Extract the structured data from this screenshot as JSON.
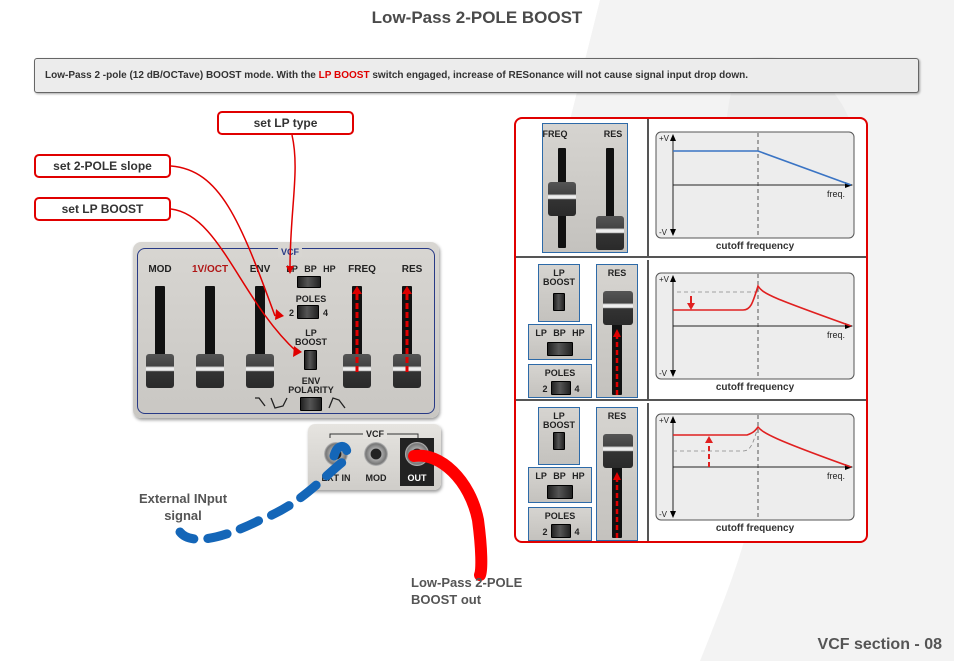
{
  "title": "Low-Pass 2-POLE BOOST",
  "description": {
    "before": "Low-Pass 2 -pole (12 dB/OCTave) BOOST mode. With the ",
    "highlight": "LP BOOST",
    "after": " switch engaged, increase of RESonance will not cause signal input drop down."
  },
  "callouts": {
    "lp_type": "set LP type",
    "pole_slope": "set 2-POLE slope",
    "lp_boost": "set LP BOOST"
  },
  "vcf_panel": {
    "section_tag": "VCF",
    "channels": [
      "MOD",
      "1V/OCT",
      "ENV",
      "FREQ",
      "RES"
    ],
    "filter_type": {
      "options": [
        "LP",
        "BP",
        "HP"
      ],
      "selected": "LP"
    },
    "poles": {
      "label": "POLES",
      "options": [
        "2",
        "4"
      ],
      "selected": "2"
    },
    "lp_boost": {
      "label_line1": "LP",
      "label_line2": "BOOST",
      "state": "on"
    },
    "env_polarity": {
      "label_line1": "ENV",
      "label_line2": "POLARITY"
    }
  },
  "jacks": {
    "section_tag": "VCF",
    "items": [
      "EXT IN",
      "MOD",
      "OUT"
    ]
  },
  "annotations": {
    "external_input_line1": "External INput",
    "external_input_line2": "signal",
    "output_line1": "Low-Pass 2-POLE",
    "output_line2": "BOOST out"
  },
  "diagram": {
    "rows": [
      {
        "controls": {
          "sliders": [
            "FREQ",
            "RES"
          ]
        },
        "graph": {
          "y_top": "+V",
          "y_bottom": "-V",
          "x_label": "freq.",
          "caption": "cutoff frequency",
          "curve": "flat-then-rolloff",
          "color": "#3a74c4"
        }
      },
      {
        "controls": {
          "lp_boost": "LP BOOST",
          "type_options": [
            "LP",
            "BP",
            "HP"
          ],
          "poles_label": "POLES",
          "poles_options": [
            "2",
            "4"
          ],
          "slider": "RES"
        },
        "graph": {
          "y_top": "+V",
          "y_bottom": "-V",
          "x_label": "freq.",
          "caption": "cutoff frequency",
          "curve": "resonance-drop",
          "color": "#e02020"
        }
      },
      {
        "controls": {
          "lp_boost": "LP BOOST",
          "type_options": [
            "LP",
            "BP",
            "HP"
          ],
          "poles_label": "POLES",
          "poles_options": [
            "2",
            "4"
          ],
          "slider": "RES"
        },
        "graph": {
          "y_top": "+V",
          "y_bottom": "-V",
          "x_label": "freq.",
          "caption": "cutoff frequency",
          "curve": "boost-level-kept",
          "color": "#e02020"
        }
      }
    ]
  },
  "footer": "VCF section - 08",
  "colors": {
    "accent": "#e00000",
    "blue_cable": "#1466b8",
    "panel_border": "#283a86"
  }
}
